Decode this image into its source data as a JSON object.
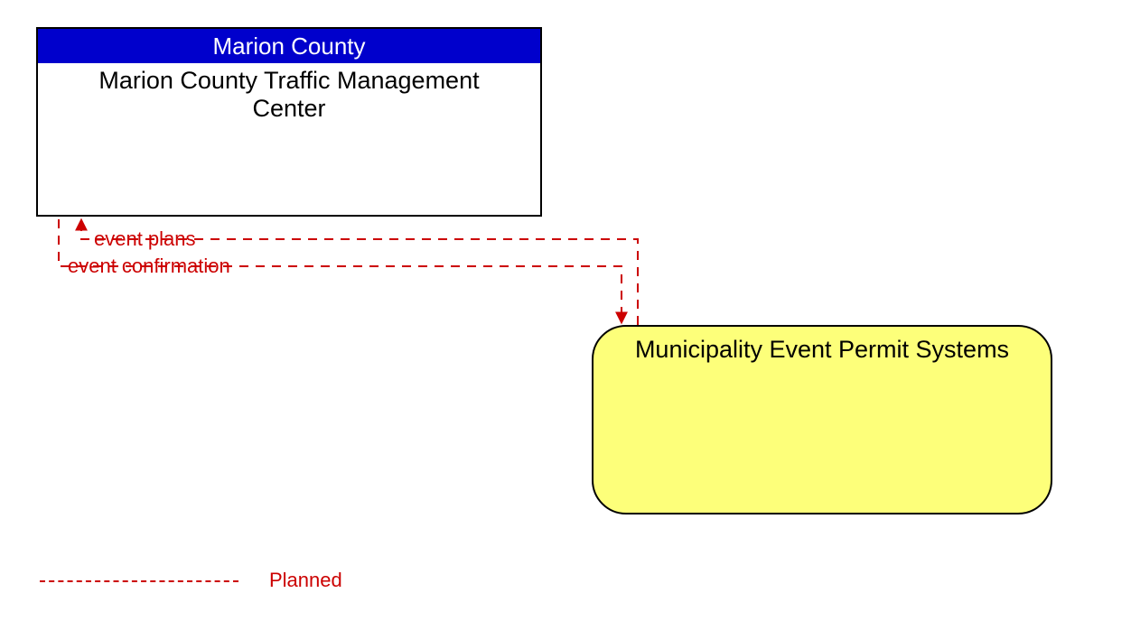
{
  "nodes": {
    "county": {
      "header": "Marion County",
      "title": "Marion County Traffic Management Center"
    },
    "municipality": {
      "title": "Municipality Event Permit Systems"
    }
  },
  "flows": {
    "event_plans": "event plans",
    "event_confirmation": "event confirmation"
  },
  "legend": {
    "planned": "Planned"
  },
  "colors": {
    "planned_line": "#cc0000",
    "county_header_bg": "#0000cc",
    "municipality_bg": "#fdff7a"
  }
}
